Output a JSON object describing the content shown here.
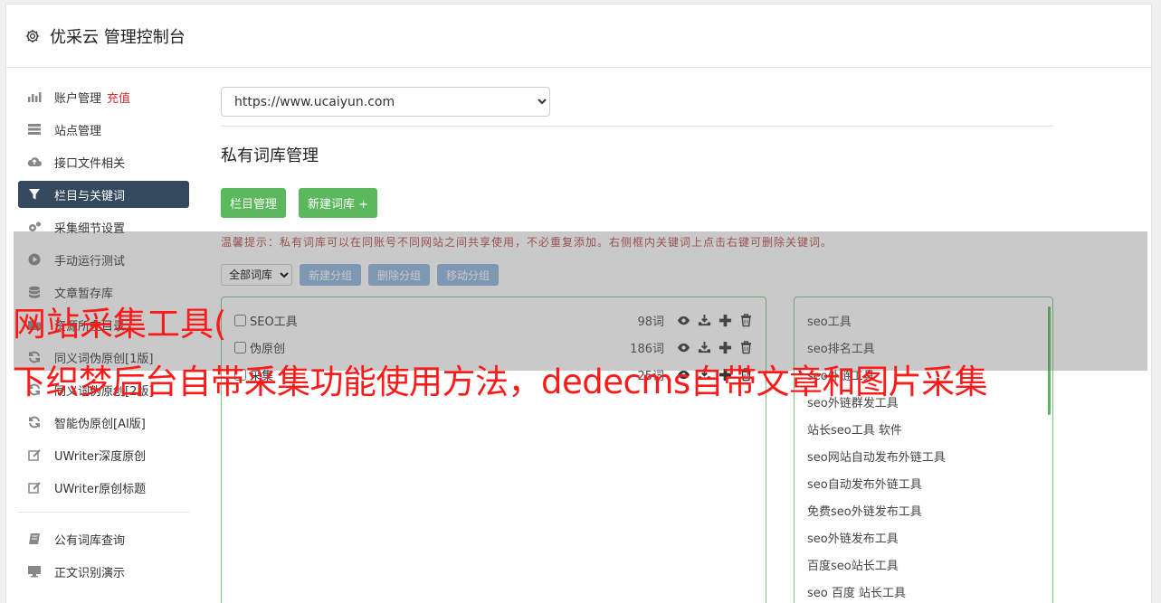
{
  "header": {
    "title": "优采云 管理控制台"
  },
  "sidebar": {
    "items": [
      {
        "label": "账户管理",
        "badge": "充值",
        "icon": "bar-chart-icon"
      },
      {
        "label": "站点管理",
        "icon": "server-icon"
      },
      {
        "label": "接口文件相关",
        "icon": "cloud-upload-icon"
      },
      {
        "label": "栏目与关键词",
        "icon": "filter-icon",
        "active": true
      },
      {
        "label": "采集细节设置",
        "icon": "gears-icon"
      },
      {
        "label": "手动运行测试",
        "icon": "play-circle-icon"
      },
      {
        "label": "文章暂存库",
        "icon": "database-icon"
      },
      {
        "label": "资源所在目录",
        "icon": "folder-icon"
      },
      {
        "label": "同义词伪原创[1版]",
        "icon": "refresh-icon"
      },
      {
        "label": "同义词伪原创[2版]",
        "icon": "refresh-icon"
      },
      {
        "label": "智能伪原创[AI版]",
        "icon": "refresh-icon"
      },
      {
        "label": "UWriter深度原创",
        "icon": "edit-icon"
      },
      {
        "label": "UWriter原创标题",
        "icon": "edit-icon"
      }
    ],
    "items2": [
      {
        "label": "公有词库查询",
        "icon": "book-icon"
      },
      {
        "label": "正文识别演示",
        "icon": "monitor-icon"
      }
    ]
  },
  "main": {
    "site_select": "https://www.ucaiyun.com",
    "section_title": "私有词库管理",
    "btn_column": "栏目管理",
    "btn_new_lib": "新建词库 +",
    "tip": "温馨提示：私有词库可以在同账号不同网站之间共享使用，不必重复添加。右侧框内关键词上点击右键可删除关键词。",
    "filter_select": "全部词库",
    "btn_new_group": "新建分组",
    "btn_del_group": "删除分组",
    "btn_move_group": "移动分组",
    "libraries": [
      {
        "name": "SEO工具",
        "count": "98词"
      },
      {
        "name": "伪原创",
        "count": "186词"
      },
      {
        "name": "采集",
        "count": "25词"
      }
    ],
    "keywords": [
      "seo工具",
      "seo排名工具",
      "seo外链工具",
      "seo外链群发工具",
      "站长seo工具 软件",
      "seo网站自动发布外链工具",
      "seo自动发布外链工具",
      "免费seo外链发布工具",
      "seo外链发布工具",
      "百度seo站长工具",
      "seo 百度 站长工具"
    ]
  },
  "overlay": {
    "line1": "网站采集工具(",
    "line2": "下织梦后台自带采集功能使用方法，dedecms自带文章和图片采集"
  },
  "colors": {
    "active_nav": "#34495e",
    "green": "#5cb85c",
    "blue": "#8cb4dd",
    "caption": "#ff1a1a"
  }
}
